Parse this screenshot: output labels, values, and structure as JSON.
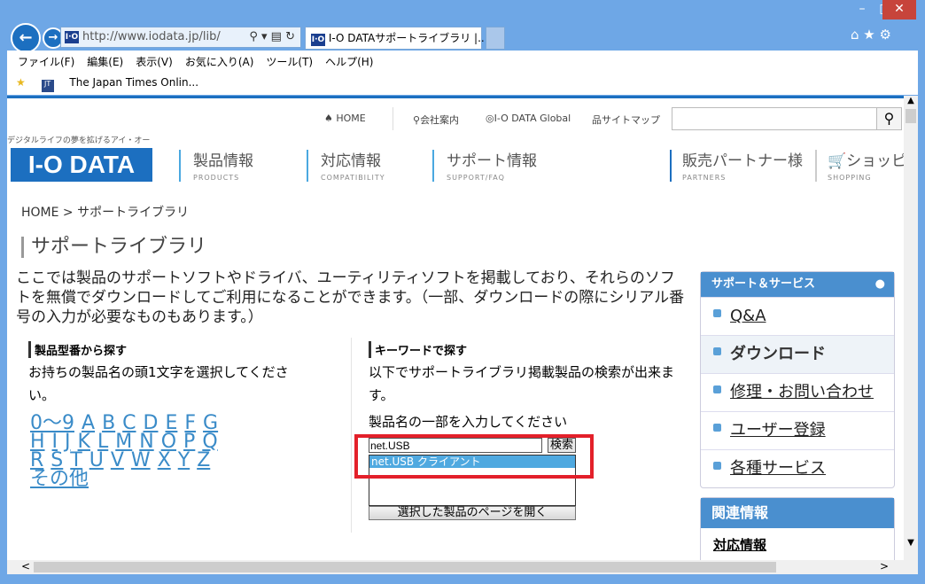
{
  "browser": {
    "address": "http://www.iodata.jp/lib/",
    "tab_title": "I-O DATAサポートライブラリ |...",
    "menu": [
      "ファイル(F)",
      "編集(E)",
      "表示(V)",
      "お気に入り(A)",
      "ツール(T)",
      "ヘルプ(H)"
    ],
    "favorite": "The Japan Times Onlin..."
  },
  "site": {
    "tagline": "デジタルライフの夢を拡げるアイ・オー",
    "logo": "I-O DATA",
    "topnav": [
      "HOME",
      "会社案内",
      "I-O DATA Global",
      "サイトマップ"
    ],
    "mainnav": [
      {
        "label": "製品情報",
        "sub": "PRODUCTS"
      },
      {
        "label": "対応情報",
        "sub": "COMPATIBILITY"
      },
      {
        "label": "サポート情報",
        "sub": "SUPPORT/FAQ"
      },
      {
        "label": "販売パートナー様",
        "sub": "PARTNERS"
      },
      {
        "label": "ショッピン",
        "sub": "SHOPPING"
      }
    ]
  },
  "breadcrumb": "HOME > サポートライブラリ",
  "page_title": "サポートライブラリ",
  "intro": "ここでは製品のサポートソフトやドライバ、ユーティリティソフトを掲載しており、それらのソフトを無償でダウンロードしてご利用になることができます。（一部、ダウンロードの際にシリアル番号の入力が必要なものもあります。）",
  "model_search": {
    "heading": "製品型番から探す",
    "desc": "お持ちの製品名の頭1文字を選択してください。",
    "rows": [
      [
        "0〜9",
        "A",
        "B",
        "C",
        "D",
        "E",
        "F",
        "G"
      ],
      [
        "H",
        "I",
        "J",
        "K",
        "L",
        "M",
        "N",
        "O",
        "P",
        "Q"
      ],
      [
        "R",
        "S",
        "T",
        "U",
        "V",
        "W",
        "X",
        "Y",
        "Z"
      ],
      [
        "その他"
      ]
    ]
  },
  "keyword_search": {
    "heading": "キーワードで探す",
    "desc": "以下でサポートライブラリ掲載製品の検索が出来ます。",
    "label": "製品名の一部を入力してください",
    "value": "net.USB",
    "search_btn": "検索",
    "results": [
      "net.USB クライアント"
    ],
    "open_btn": "選択した製品のページを開く"
  },
  "sidebar": {
    "heading": "サポート＆サービス",
    "items": [
      "Q&A",
      "ダウンロード",
      "修理・お問い合わせ",
      "ユーザー登録",
      "各種サービス"
    ],
    "related_heading": "関連情報",
    "related_item": "対応情報"
  }
}
